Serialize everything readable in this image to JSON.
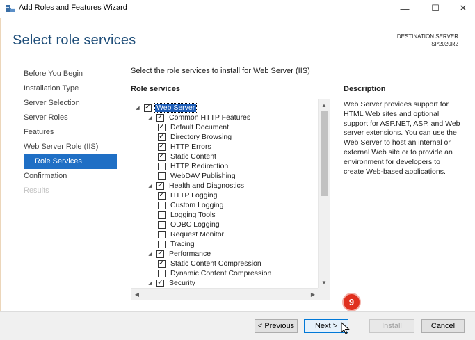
{
  "window": {
    "title": "Add Roles and Features Wizard",
    "minimize_glyph": "—",
    "maximize_glyph": "☐",
    "close_glyph": "✕",
    "icon": "server-manager-icon"
  },
  "page": {
    "title": "Select role services",
    "destination_label": "DESTINATION SERVER",
    "destination_name": "SP2020R2"
  },
  "nav": {
    "items": [
      {
        "label": "Before You Begin",
        "state": "normal"
      },
      {
        "label": "Installation Type",
        "state": "normal"
      },
      {
        "label": "Server Selection",
        "state": "normal"
      },
      {
        "label": "Server Roles",
        "state": "normal"
      },
      {
        "label": "Features",
        "state": "normal"
      },
      {
        "label": "Web Server Role (IIS)",
        "state": "normal"
      },
      {
        "label": "Role Services",
        "state": "active"
      },
      {
        "label": "Confirmation",
        "state": "normal"
      },
      {
        "label": "Results",
        "state": "disabled"
      }
    ]
  },
  "main": {
    "instruction": "Select the role services to install for Web Server (IIS)",
    "role_services_header": "Role services",
    "description_header": "Description",
    "description": "Web Server provides support for HTML Web sites and optional support for ASP.NET, ASP, and Web server extensions. You can use the Web Server to host an internal or external Web site or to provide an environment for developers to create Web-based applications.",
    "tree": [
      {
        "label": "Web Server",
        "level": 0,
        "expander": "◢",
        "checked": true,
        "selected": true
      },
      {
        "label": "Common HTTP Features",
        "level": 1,
        "expander": "◢",
        "checked": true
      },
      {
        "label": "Default Document",
        "level": 2,
        "expander": "",
        "checked": true
      },
      {
        "label": "Directory Browsing",
        "level": 2,
        "expander": "",
        "checked": true
      },
      {
        "label": "HTTP Errors",
        "level": 2,
        "expander": "",
        "checked": true
      },
      {
        "label": "Static Content",
        "level": 2,
        "expander": "",
        "checked": true
      },
      {
        "label": "HTTP Redirection",
        "level": 2,
        "expander": "",
        "checked": false
      },
      {
        "label": "WebDAV Publishing",
        "level": 2,
        "expander": "",
        "checked": false
      },
      {
        "label": "Health and Diagnostics",
        "level": 1,
        "expander": "◢",
        "checked": true
      },
      {
        "label": "HTTP Logging",
        "level": 2,
        "expander": "",
        "checked": true
      },
      {
        "label": "Custom Logging",
        "level": 2,
        "expander": "",
        "checked": false
      },
      {
        "label": "Logging Tools",
        "level": 2,
        "expander": "",
        "checked": false
      },
      {
        "label": "ODBC Logging",
        "level": 2,
        "expander": "",
        "checked": false
      },
      {
        "label": "Request Monitor",
        "level": 2,
        "expander": "",
        "checked": false
      },
      {
        "label": "Tracing",
        "level": 2,
        "expander": "",
        "checked": false
      },
      {
        "label": "Performance",
        "level": 1,
        "expander": "◢",
        "checked": true
      },
      {
        "label": "Static Content Compression",
        "level": 2,
        "expander": "",
        "checked": true
      },
      {
        "label": "Dynamic Content Compression",
        "level": 2,
        "expander": "",
        "checked": false
      },
      {
        "label": "Security",
        "level": 1,
        "expander": "◢",
        "checked": true
      }
    ]
  },
  "buttons": {
    "previous": "< Previous",
    "next": "Next >",
    "install": "Install",
    "cancel": "Cancel"
  },
  "annotation": {
    "step_number": "9"
  },
  "colors": {
    "title_blue": "#1f4e79",
    "active_nav": "#1f6fc5",
    "badge_red": "#e0301e"
  }
}
